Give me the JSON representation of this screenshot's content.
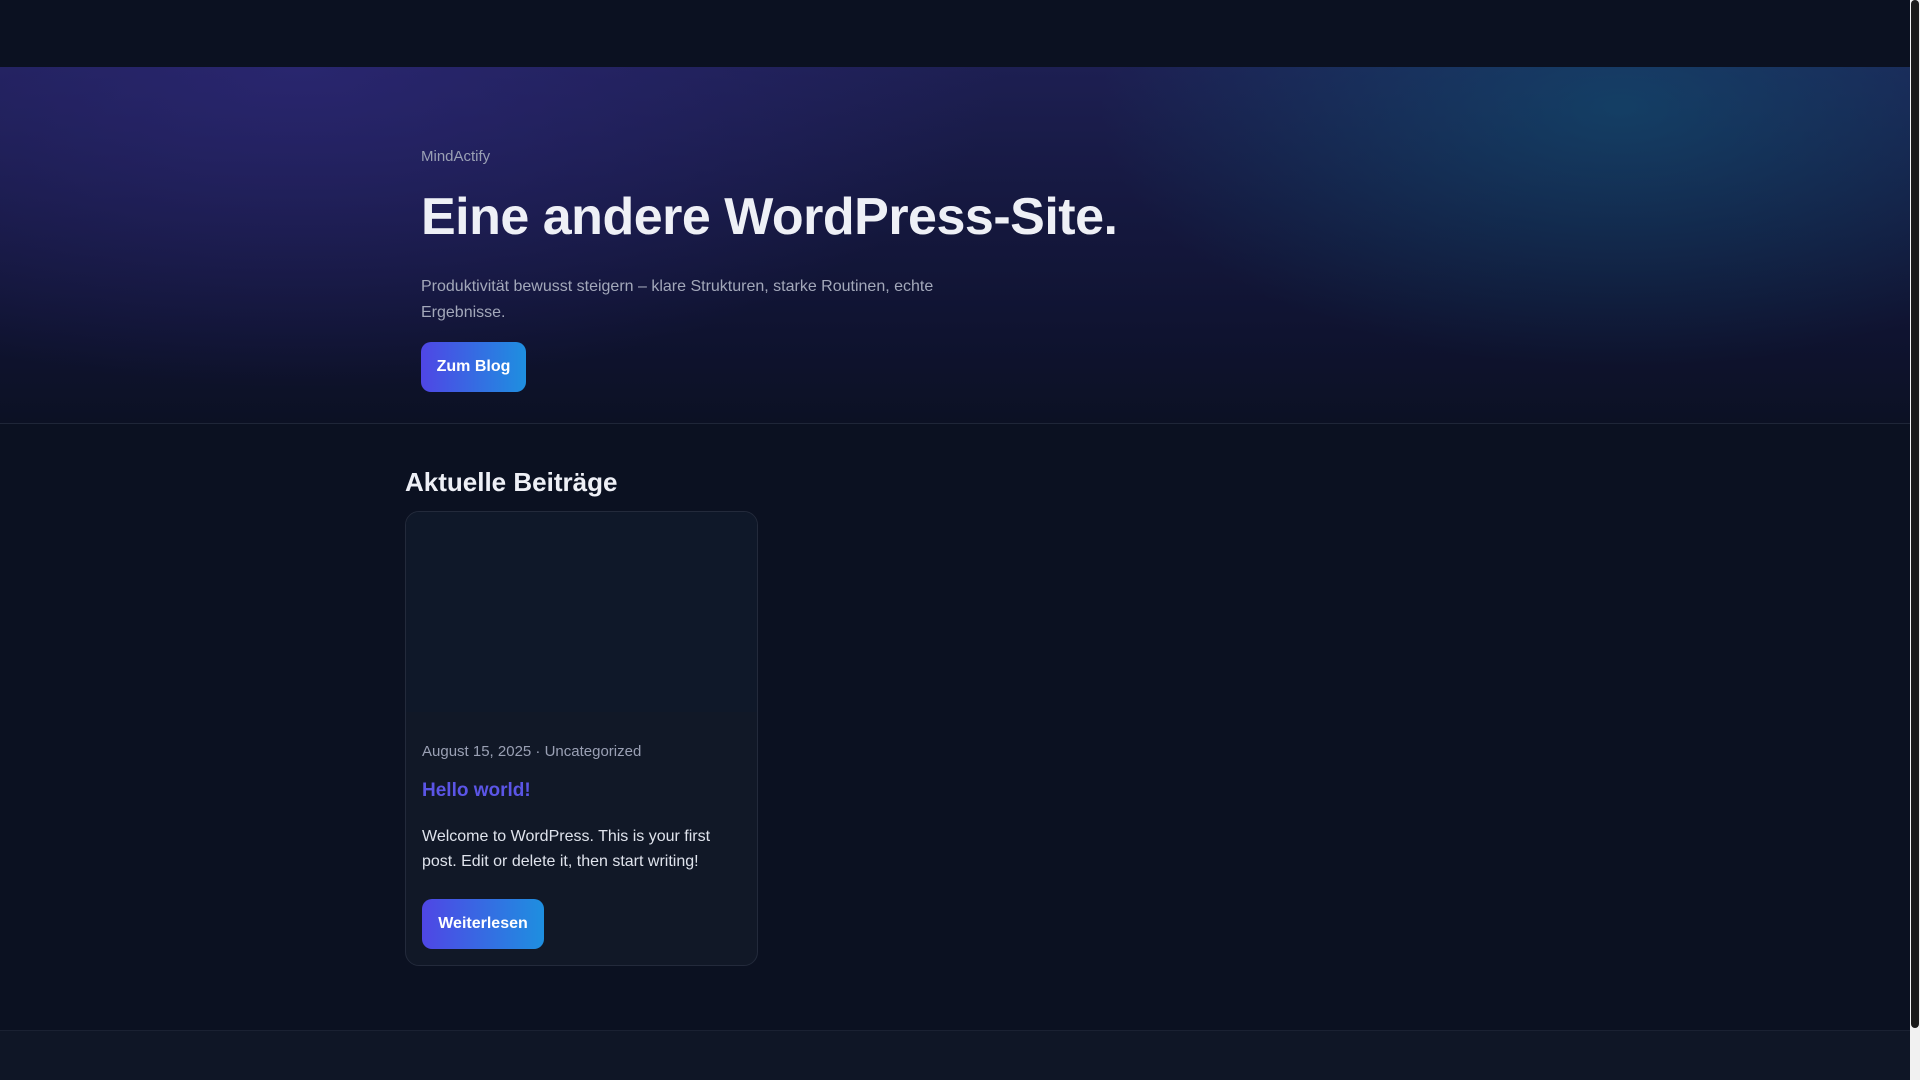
{
  "hero": {
    "brand": "MindActify",
    "title": "Eine andere WordPress-Site.",
    "subtitle": "Produktivität bewusst steigern – klare Strukturen, starke Routinen, echte Ergebnisse.",
    "cta_label": "Zum Blog"
  },
  "posts_section": {
    "title": "Aktuelle Beiträge",
    "posts": [
      {
        "meta": "August 15, 2025 · Uncategorized",
        "title": "Hello world!",
        "excerpt": "Welcome to WordPress. This is your first post. Edit or delete it, then start writing!",
        "read_more_label": "Weiterlesen"
      }
    ]
  },
  "colors": {
    "background": "#0b1121",
    "accent_start": "#4f46e5",
    "accent_end": "#1e8fe0",
    "post_title": "#5b55e6"
  }
}
